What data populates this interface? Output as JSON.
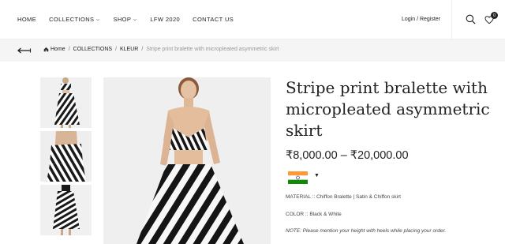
{
  "header": {
    "nav": [
      {
        "label": "HOME",
        "dropdown": false
      },
      {
        "label": "COLLECTIONS",
        "dropdown": true
      },
      {
        "label": "SHOP",
        "dropdown": true
      },
      {
        "label": "LFW 2020",
        "dropdown": false
      },
      {
        "label": "CONTACT US",
        "dropdown": false
      }
    ],
    "login_label": "Login / Register",
    "wishlist_count": "0"
  },
  "breadcrumb": {
    "home": "Home",
    "sep": "/",
    "level1": "COLLECTIONS",
    "level2": "KLEUR",
    "current": "Stripe print bralette with micropleated asymmetric skirt"
  },
  "product": {
    "title": "Stripe print bralette with micropleated asymmetric skirt",
    "price": "₹8,000.00 – ₹20,000.00",
    "material": "MATERIAL :: Chiffon Bralette | Satin & Chiffon skirt",
    "color": "COLOR :: Black & White",
    "note_label": "NOTE:",
    "note_text": " Please mention your height with heels while placing your order.",
    "currency_caret": "▼"
  },
  "colors": {
    "flag_saffron": "#FF9933",
    "flag_white": "#FFFFFF",
    "flag_green": "#138808",
    "flag_chakra": "#000080"
  }
}
